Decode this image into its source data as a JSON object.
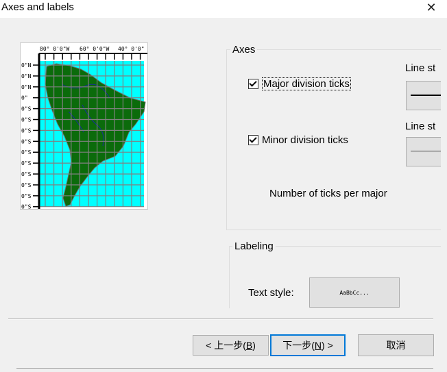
{
  "window": {
    "title": "Axes and labels",
    "close_glyph": "✕"
  },
  "preview": {
    "top_labels": [
      "80° 0'0\"W",
      "60° 0'0\"W",
      "40° 0'0\""
    ],
    "left_labels": [
      "0\"N",
      "0\"N",
      "0\"N",
      "0\"",
      "0\"S",
      "0\"S",
      "0\"S",
      "0\"S",
      "0\"S",
      "0\"S",
      "0\"S",
      "0\"S",
      "0\"S",
      "0\"S",
      "0\"S"
    ],
    "colors": {
      "ocean": "#00ffff",
      "land": "#0b6b0b",
      "grid": "#808080",
      "rivers": "#1a2aa0"
    }
  },
  "axes": {
    "group_label": "Axes",
    "major_ticks": {
      "label": "Major division ticks",
      "checked": true
    },
    "minor_ticks": {
      "label": "Minor division ticks",
      "checked": true
    },
    "line_style_major_label": "Line st",
    "line_style_minor_label": "Line st",
    "ticks_per_major_label": "Number of ticks per major"
  },
  "labeling": {
    "group_label": "Labeling",
    "text_style_label": "Text style:",
    "text_style_sample": "AaBbCc..."
  },
  "buttons": {
    "back": {
      "prefix": "< 上一步(",
      "mnemonic": "B",
      "suffix": ")"
    },
    "next": {
      "prefix": "下一步(",
      "mnemonic": "N",
      "suffix": ") >"
    },
    "cancel": "取消"
  }
}
